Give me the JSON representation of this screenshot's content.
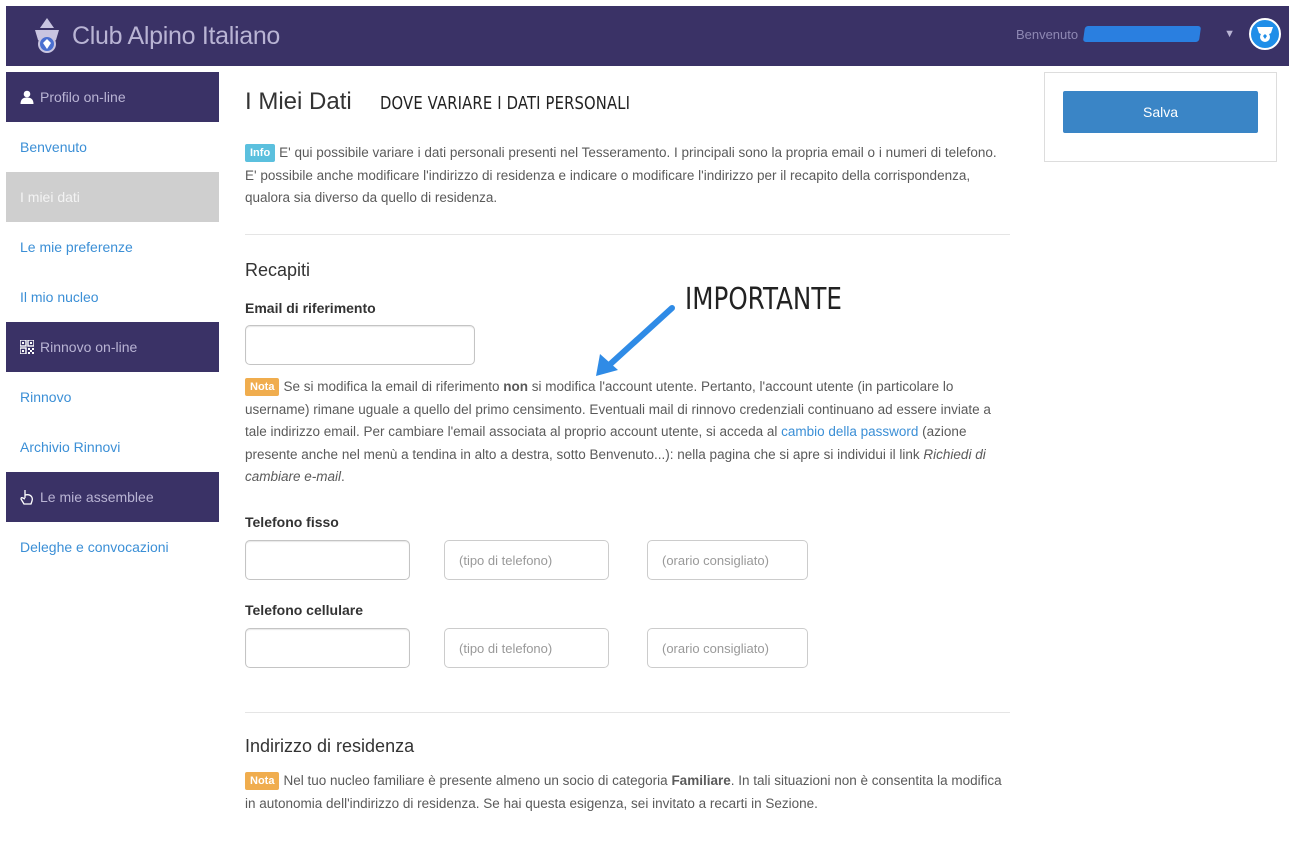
{
  "header": {
    "title": "Club Alpino Italiano",
    "welcome": "Benvenuto",
    "logo_icon": "cai-emblem-icon",
    "caret_icon": "caret-down-icon",
    "caret_glyph": "▼",
    "colors": {
      "bar": "#3a3266",
      "title": "#b9b4d4",
      "avatar": "#1f8ee8"
    }
  },
  "sidebar": {
    "sections": [
      {
        "header": "Profilo on-line",
        "icon": "user-icon"
      },
      {
        "header": "Rinnovo on-line",
        "icon": "qrcode-icon"
      },
      {
        "header": "Le mie assemblee",
        "icon": "hand-icon"
      }
    ],
    "links": {
      "benvenuto": "Benvenuto",
      "miei_dati": "I miei dati",
      "preferenze": "Le mie preferenze",
      "nucleo": "Il mio nucleo",
      "rinnovo": "Rinnovo",
      "archivio": "Archivio Rinnovi",
      "deleghe": "Deleghe e convocazioni"
    },
    "active_link": "I miei dati"
  },
  "main": {
    "title": "I Miei Dati",
    "annotation_top": "DOVE VARIARE I DATI PERSONALI",
    "annotation_important": "IMPORTANTE",
    "info": {
      "label": "Info",
      "text": "E' qui possibile variare i dati personali presenti nel Tesseramento. I principali sono la propria email o i numeri di telefono. E' possibile anche modificare l'indirizzo di residenza e indicare o modificare l'indirizzo per il recapito della corrispondenza, qualora sia diverso da quello di residenza."
    },
    "recapiti": {
      "title": "Recapiti",
      "email_label": "Email di riferimento",
      "email_value": "",
      "note_label": "Nota",
      "note_part1": "Se si modifica la email di riferimento ",
      "note_bold": "non",
      "note_part2": " si modifica l'account utente. Pertanto, l'account utente (in particolare lo username) rimane uguale a quello del primo censimento. Eventuali mail di rinnovo credenziali continuano ad essere inviate a tale indirizzo email. Per cambiare l'email associata al proprio account utente, si acceda al ",
      "note_link": "cambio della password",
      "note_part3": " (azione presente anche nel menù a tendina in alto a destra, sotto Benvenuto...): nella pagina che si apre si individui il link ",
      "note_italic": "Richiedi di cambiare e-mail",
      "note_end": ".",
      "fisso_label": "Telefono fisso",
      "cell_label": "Telefono cellulare",
      "tipo_placeholder": "(tipo di telefono)",
      "orario_placeholder": "(orario consigliato)"
    },
    "residenza": {
      "title": "Indirizzo di residenza",
      "note_label": "Nota",
      "note_part1": "Nel tuo nucleo familiare è presente almeno un socio di categoria ",
      "note_bold": "Familiare",
      "note_part2": ". In tali situazioni non è consentita la modifica in autonomia dell'indirizzo di residenza. Se hai questa esigenza, sei invitato a recarti in Sezione."
    }
  },
  "actions": {
    "save_label": "Salva"
  }
}
